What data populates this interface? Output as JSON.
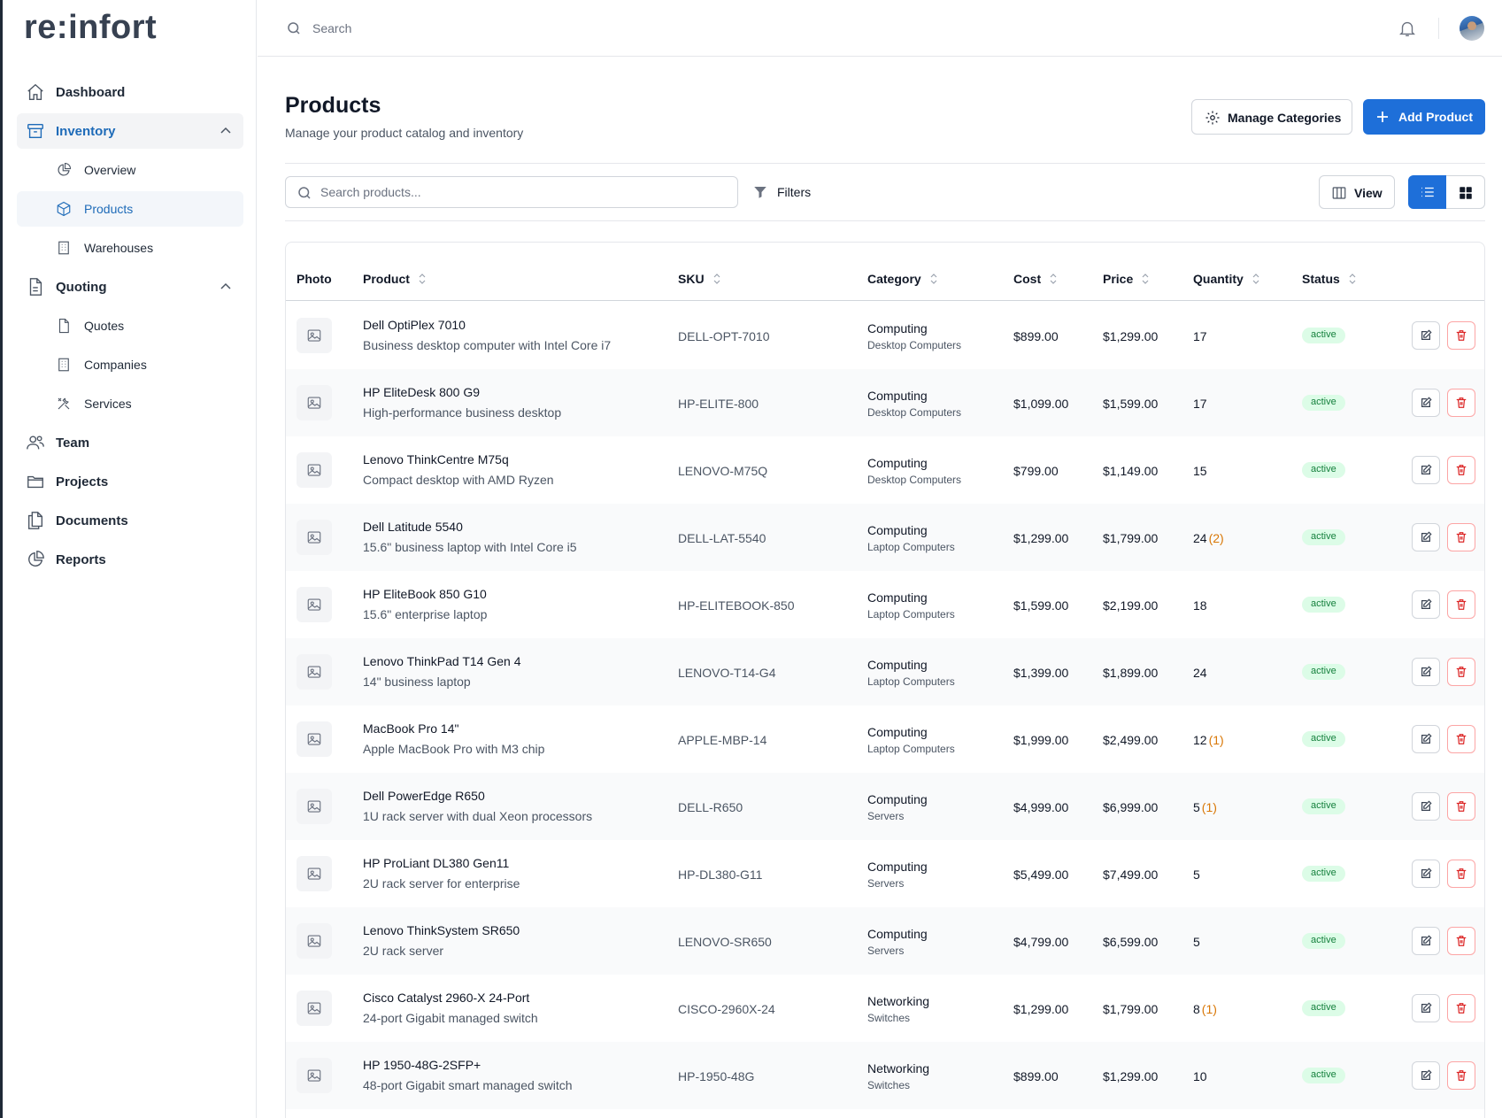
{
  "app": {
    "logo": "re:infort"
  },
  "topbar": {
    "search_placeholder": "Search"
  },
  "sidebar": {
    "items": [
      {
        "label": "Dashboard"
      },
      {
        "label": "Inventory",
        "children": [
          {
            "label": "Overview"
          },
          {
            "label": "Products"
          },
          {
            "label": "Warehouses"
          }
        ]
      },
      {
        "label": "Quoting",
        "children": [
          {
            "label": "Quotes"
          },
          {
            "label": "Companies"
          },
          {
            "label": "Services"
          }
        ]
      },
      {
        "label": "Team"
      },
      {
        "label": "Projects"
      },
      {
        "label": "Documents"
      },
      {
        "label": "Reports"
      }
    ]
  },
  "page": {
    "title": "Products",
    "subtitle": "Manage your product catalog and inventory",
    "manage_categories_label": "Manage Categories",
    "add_product_label": "Add Product",
    "search_placeholder": "Search products...",
    "filters_label": "Filters",
    "view_label": "View"
  },
  "table": {
    "columns": [
      "Photo",
      "Product",
      "SKU",
      "Category",
      "Cost",
      "Price",
      "Quantity",
      "Status"
    ],
    "rows": [
      {
        "name": "Dell OptiPlex 7010",
        "desc": "Business desktop computer with Intel Core i7",
        "sku": "DELL-OPT-7010",
        "category": "Computing",
        "subcategory": "Desktop Computers",
        "cost": "$899.00",
        "price": "$1,299.00",
        "qty": "17",
        "reserved": "",
        "status": "active"
      },
      {
        "name": "HP EliteDesk 800 G9",
        "desc": "High-performance business desktop",
        "sku": "HP-ELITE-800",
        "category": "Computing",
        "subcategory": "Desktop Computers",
        "cost": "$1,099.00",
        "price": "$1,599.00",
        "qty": "17",
        "reserved": "",
        "status": "active"
      },
      {
        "name": "Lenovo ThinkCentre M75q",
        "desc": "Compact desktop with AMD Ryzen",
        "sku": "LENOVO-M75Q",
        "category": "Computing",
        "subcategory": "Desktop Computers",
        "cost": "$799.00",
        "price": "$1,149.00",
        "qty": "15",
        "reserved": "",
        "status": "active"
      },
      {
        "name": "Dell Latitude 5540",
        "desc": "15.6\" business laptop with Intel Core i5",
        "sku": "DELL-LAT-5540",
        "category": "Computing",
        "subcategory": "Laptop Computers",
        "cost": "$1,299.00",
        "price": "$1,799.00",
        "qty": "24",
        "reserved": "(2)",
        "status": "active"
      },
      {
        "name": "HP EliteBook 850 G10",
        "desc": "15.6\" enterprise laptop",
        "sku": "HP-ELITEBOOK-850",
        "category": "Computing",
        "subcategory": "Laptop Computers",
        "cost": "$1,599.00",
        "price": "$2,199.00",
        "qty": "18",
        "reserved": "",
        "status": "active"
      },
      {
        "name": "Lenovo ThinkPad T14 Gen 4",
        "desc": "14\" business laptop",
        "sku": "LENOVO-T14-G4",
        "category": "Computing",
        "subcategory": "Laptop Computers",
        "cost": "$1,399.00",
        "price": "$1,899.00",
        "qty": "24",
        "reserved": "",
        "status": "active"
      },
      {
        "name": "MacBook Pro 14\"",
        "desc": "Apple MacBook Pro with M3 chip",
        "sku": "APPLE-MBP-14",
        "category": "Computing",
        "subcategory": "Laptop Computers",
        "cost": "$1,999.00",
        "price": "$2,499.00",
        "qty": "12",
        "reserved": "(1)",
        "status": "active"
      },
      {
        "name": "Dell PowerEdge R650",
        "desc": "1U rack server with dual Xeon processors",
        "sku": "DELL-R650",
        "category": "Computing",
        "subcategory": "Servers",
        "cost": "$4,999.00",
        "price": "$6,999.00",
        "qty": "5",
        "reserved": "(1)",
        "status": "active"
      },
      {
        "name": "HP ProLiant DL380 Gen11",
        "desc": "2U rack server for enterprise",
        "sku": "HP-DL380-G11",
        "category": "Computing",
        "subcategory": "Servers",
        "cost": "$5,499.00",
        "price": "$7,499.00",
        "qty": "5",
        "reserved": "",
        "status": "active"
      },
      {
        "name": "Lenovo ThinkSystem SR650",
        "desc": "2U rack server",
        "sku": "LENOVO-SR650",
        "category": "Computing",
        "subcategory": "Servers",
        "cost": "$4,799.00",
        "price": "$6,599.00",
        "qty": "5",
        "reserved": "",
        "status": "active"
      },
      {
        "name": "Cisco Catalyst 2960-X 24-Port",
        "desc": "24-port Gigabit managed switch",
        "sku": "CISCO-2960X-24",
        "category": "Networking",
        "subcategory": "Switches",
        "cost": "$1,299.00",
        "price": "$1,799.00",
        "qty": "8",
        "reserved": "(1)",
        "status": "active"
      },
      {
        "name": "HP 1950-48G-2SFP+",
        "desc": "48-port Gigabit smart managed switch",
        "sku": "HP-1950-48G",
        "category": "Networking",
        "subcategory": "Switches",
        "cost": "$899.00",
        "price": "$1,299.00",
        "qty": "10",
        "reserved": "",
        "status": "active"
      }
    ]
  },
  "colors": {
    "accent": "#1e6fd9",
    "active_nav": "#1e6bb8",
    "status_bg": "#dcfce7",
    "status_text": "#15803d",
    "reserved": "#d97706",
    "delete": "#dc2626"
  },
  "icons": [
    "home-icon",
    "archive-icon",
    "chart-pie-icon",
    "cube-icon",
    "building-icon",
    "document-icon",
    "tools-icon",
    "users-icon",
    "folder-icon",
    "documents-icon",
    "bell-icon",
    "search-icon",
    "gear-icon",
    "plus-icon",
    "funnel-icon",
    "columns-icon",
    "list-icon",
    "grid-icon",
    "image-icon",
    "edit-icon",
    "trash-icon"
  ]
}
